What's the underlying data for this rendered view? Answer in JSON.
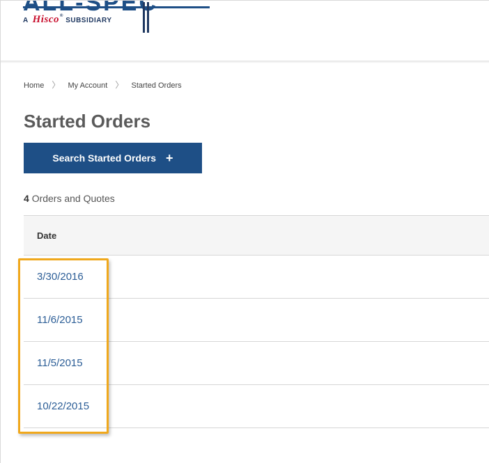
{
  "header": {
    "logo": {
      "brand_text": "ALL-SPEC",
      "prefix": "A",
      "parent_brand": "Hisco",
      "suffix": "SUBSIDIARY"
    }
  },
  "breadcrumb": {
    "items": [
      {
        "label": "Home"
      },
      {
        "label": "My Account"
      },
      {
        "label": "Started Orders"
      }
    ],
    "separator": "〉"
  },
  "page": {
    "title": "Started Orders"
  },
  "search_button": {
    "label": "Search Started Orders",
    "icon": "plus-icon",
    "icon_glyph": "+"
  },
  "results": {
    "count": "4",
    "label": "Orders and Quotes"
  },
  "table": {
    "columns": [
      {
        "label": "Date"
      }
    ],
    "rows": [
      {
        "date": "3/30/2016"
      },
      {
        "date": "11/6/2015"
      },
      {
        "date": "11/5/2015"
      },
      {
        "date": "10/22/2015"
      }
    ]
  },
  "colors": {
    "primary": "#1e4f86",
    "link": "#2b5d96",
    "highlight": "#f0a81c",
    "brand_red": "#c8102e"
  }
}
